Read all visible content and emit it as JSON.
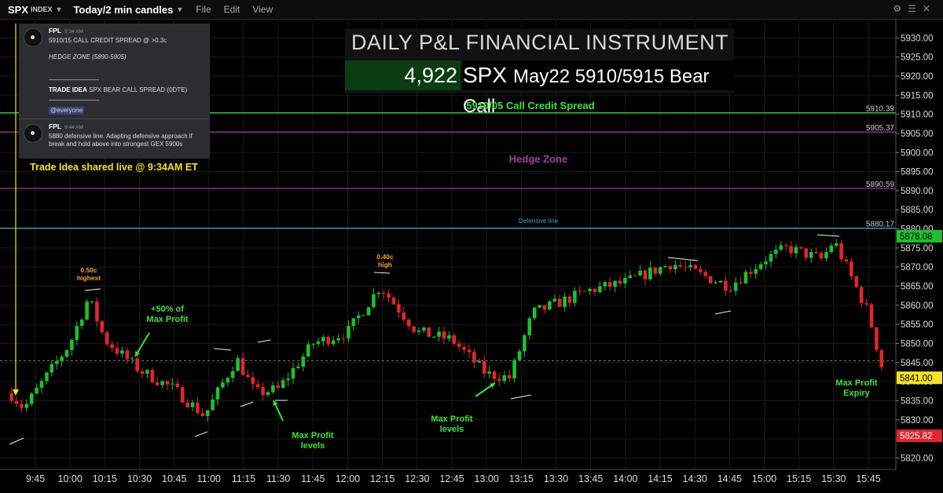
{
  "toolbar": {
    "symbol": "SPX",
    "symbol_sub": "INDEX",
    "timeframe": "Today/2 min candles",
    "menu": [
      "File",
      "Edit",
      "View"
    ]
  },
  "colors": {
    "up": "#1fbf30",
    "down": "#e0262c",
    "call_spread_line": "#4cd64c",
    "hedge_line": "#9c3a9c",
    "defensive_line": "#3aa8c8",
    "annotation_orange": "#f5a623",
    "annotation_green": "#3ee03e",
    "annotation_yellow": "#f5e22a",
    "hedge_label": "#a13fa8",
    "defensive_label": "#3aa8c8"
  },
  "chat": {
    "msg1": {
      "name": "FPL",
      "time": "9:34 AM",
      "line1": "5910/15 CALL CREDIT SPREAD @ >0.3c",
      "line2": "HEDGE ZONE (5890-5905)",
      "dash1": "————————",
      "trade_idea_bold": "TRADE IDEA",
      "trade_idea_rest": " SPX BEAR CALL SPREAD (0DTE)",
      "dash2": "————————",
      "mention": "@everyone"
    },
    "msg2": {
      "name": "FPL",
      "time": "9:44 AM",
      "text": "5880 defensive line. Adapting defensive approach if break and hold above into strongest GEX 5900s"
    }
  },
  "pnl_box": {
    "title": "DAILY P&L FINANCIAL INSTRUMENT",
    "value": "4,922",
    "instrument_ticker": "SPX",
    "instrument_desc": "May22 5910/5915 Bear Call"
  },
  "annotations": {
    "trade_idea": "Trade Idea shared live @ 9:34AM ET",
    "call_spread": "5910/05 Call Credit Spread",
    "hedge_zone": "Hedge Zone",
    "defensive_line": "Defensive line",
    "highest": [
      "0.50c",
      "highest"
    ],
    "high": [
      "0.40c",
      "high"
    ],
    "half_profit": [
      "+50% of",
      "Max Profit"
    ],
    "max_profit_1": [
      "Max Profit",
      "levels"
    ],
    "max_profit_2": [
      "Max Profit",
      "levels"
    ],
    "max_profit_expiry": [
      "Max Profit",
      "Expiry"
    ]
  },
  "chart_data": {
    "type": "candlestick",
    "ylim": [
      5817,
      5935
    ],
    "y_ticks": [
      "5820.00",
      "5825.00",
      "5830.00",
      "5835.00",
      "5840.00",
      "5845.00",
      "5850.00",
      "5855.00",
      "5860.00",
      "5865.00",
      "5870.00",
      "5875.00",
      "5880.00",
      "5885.00",
      "5890.00",
      "5895.00",
      "5900.00",
      "5905.00",
      "5910.00",
      "5915.00",
      "5920.00",
      "5925.00",
      "5930.00"
    ],
    "x_ticks": [
      "9:45",
      "10:00",
      "10:15",
      "10:30",
      "10:45",
      "11:00",
      "11:15",
      "11:30",
      "11:45",
      "12:00",
      "12:15",
      "12:30",
      "12:45",
      "13:00",
      "13:15",
      "13:30",
      "13:45",
      "14:00",
      "14:15",
      "14:30",
      "14:45",
      "15:00",
      "15:15",
      "15:30",
      "15:45"
    ],
    "horizontal_lines": [
      {
        "value": 5910.39,
        "label": "5910.39",
        "kind": "call_spread"
      },
      {
        "value": 5905.37,
        "label": "5905.37",
        "kind": "hedge"
      },
      {
        "value": 5890.59,
        "label": "5890.59",
        "kind": "hedge"
      },
      {
        "value": 5880.17,
        "label": "5880.17",
        "kind": "defensive"
      }
    ],
    "price_badges": [
      {
        "value": 5878.08,
        "label": "5878.08",
        "color": "#1fbf30",
        "text_color": "#000"
      },
      {
        "value": 5841.0,
        "label": "5841.00",
        "color": "#f5e22a",
        "text_color": "#000"
      },
      {
        "value": 5825.82,
        "label": "5825.82",
        "color": "#e0262c",
        "text_color": "#fff"
      }
    ],
    "prev_close_dashed": 5845.5,
    "key_points": [
      {
        "t": "9:34",
        "price": 5837
      },
      {
        "t": "9:40",
        "price": 5833
      },
      {
        "t": "10:00",
        "price": 5850
      },
      {
        "t": "10:08",
        "price": 5862
      },
      {
        "t": "10:15",
        "price": 5851
      },
      {
        "t": "10:30",
        "price": 5843
      },
      {
        "t": "10:45",
        "price": 5838
      },
      {
        "t": "10:58",
        "price": 5831
      },
      {
        "t": "11:12",
        "price": 5846
      },
      {
        "t": "11:20",
        "price": 5837
      },
      {
        "t": "11:30",
        "price": 5838
      },
      {
        "t": "11:45",
        "price": 5850
      },
      {
        "t": "12:00",
        "price": 5853
      },
      {
        "t": "12:14",
        "price": 5865
      },
      {
        "t": "12:30",
        "price": 5853
      },
      {
        "t": "12:45",
        "price": 5851
      },
      {
        "t": "13:00",
        "price": 5842
      },
      {
        "t": "13:10",
        "price": 5841
      },
      {
        "t": "13:20",
        "price": 5858
      },
      {
        "t": "13:45",
        "price": 5864
      },
      {
        "t": "14:00",
        "price": 5866
      },
      {
        "t": "14:20",
        "price": 5871
      },
      {
        "t": "14:45",
        "price": 5865
      },
      {
        "t": "15:00",
        "price": 5872
      },
      {
        "t": "15:10",
        "price": 5875
      },
      {
        "t": "15:25",
        "price": 5872
      },
      {
        "t": "15:30",
        "price": 5877
      },
      {
        "t": "15:45",
        "price": 5858
      },
      {
        "t": "15:52",
        "price": 5841
      }
    ]
  }
}
